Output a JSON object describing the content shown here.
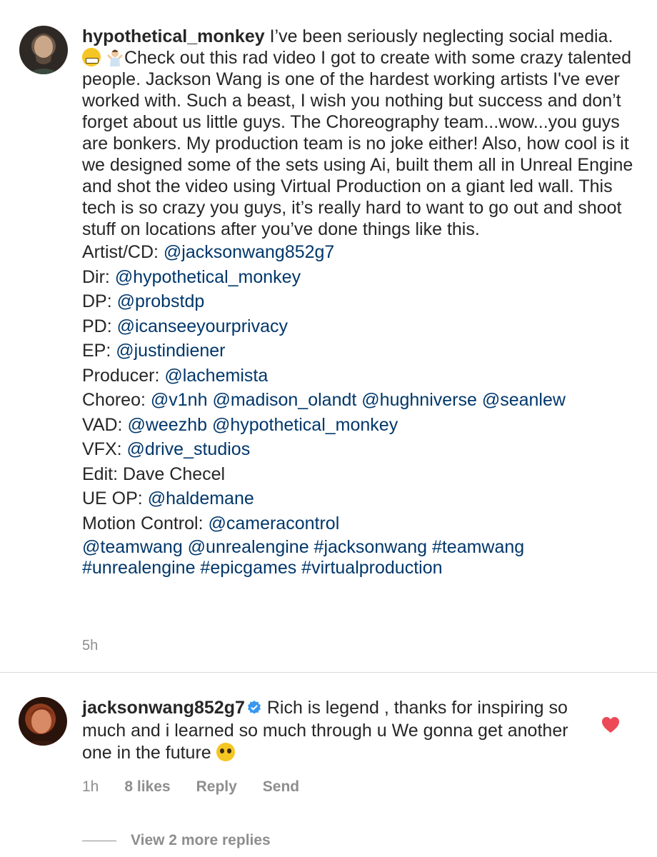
{
  "post": {
    "username": "hypothetical_monkey",
    "text_before_emoji": " I’ve been seriously neglecting social media. ",
    "text_after_emoji": "Check out this rad video I got to create with some crazy talented people. Jackson Wang is one of the hardest working artists I've ever worked with. Such a beast, I wish you nothing but success and don’t forget about us little guys. The Choreography team...wow...you guys are bonkers. My production team is no joke either! Also, how cool is it we designed some of the sets using Ai, built them all in Unreal Engine and shot the video using Virtual Production on a giant led wall. This tech is so crazy you guys, it’s really hard to want to go out and shoot stuff on locations after you’ve done things like this.",
    "credits": [
      {
        "label": "Artist/CD: ",
        "handles": [
          "@jacksonwang852g7"
        ]
      },
      {
        "label": "Dir: ",
        "handles": [
          "@hypothetical_monkey"
        ]
      },
      {
        "label": "DP: ",
        "handles": [
          "@probstdp"
        ]
      },
      {
        "label": "PD: ",
        "handles": [
          "@icanseeyourprivacy"
        ]
      },
      {
        "label": "EP: ",
        "handles": [
          "@justindiener"
        ]
      },
      {
        "label": "Producer: ",
        "handles": [
          "@lachemista"
        ]
      },
      {
        "label": "Choreo: ",
        "handles": [
          "@v1nh",
          "@madison_olandt",
          "@hughniverse",
          "@seanlew"
        ]
      },
      {
        "label": "VAD: ",
        "handles": [
          "@weezhb",
          "@hypothetical_monkey"
        ]
      },
      {
        "label": "VFX: ",
        "handles": [
          "@drive_studios"
        ]
      },
      {
        "label": "Edit: Dave Checel",
        "handles": []
      },
      {
        "label": "UE OP: ",
        "handles": [
          "@haldemane"
        ]
      },
      {
        "label": "Motion Control: ",
        "handles": [
          "@cameracontrol"
        ]
      }
    ],
    "tags_line1": "@teamwang @unrealengine #jacksonwang #teamwang",
    "tags_line2": "#unrealengine #epicgames #virtualproduction",
    "time": "5h"
  },
  "reply": {
    "username": "jacksonwang852g7",
    "text": " Rich is legend , thanks for inspiring so much and i learned so much through u We gonna get another one in the future ",
    "time": "1h",
    "likes": "8 likes",
    "reply_label": "Reply",
    "send_label": "Send",
    "liked": true,
    "heart_color": "#ed4956",
    "verified_color": "#3897f0"
  },
  "more_replies_label": "View 2 more replies",
  "icons": {
    "verified": "verified-badge-icon",
    "heart": "heart-icon"
  }
}
